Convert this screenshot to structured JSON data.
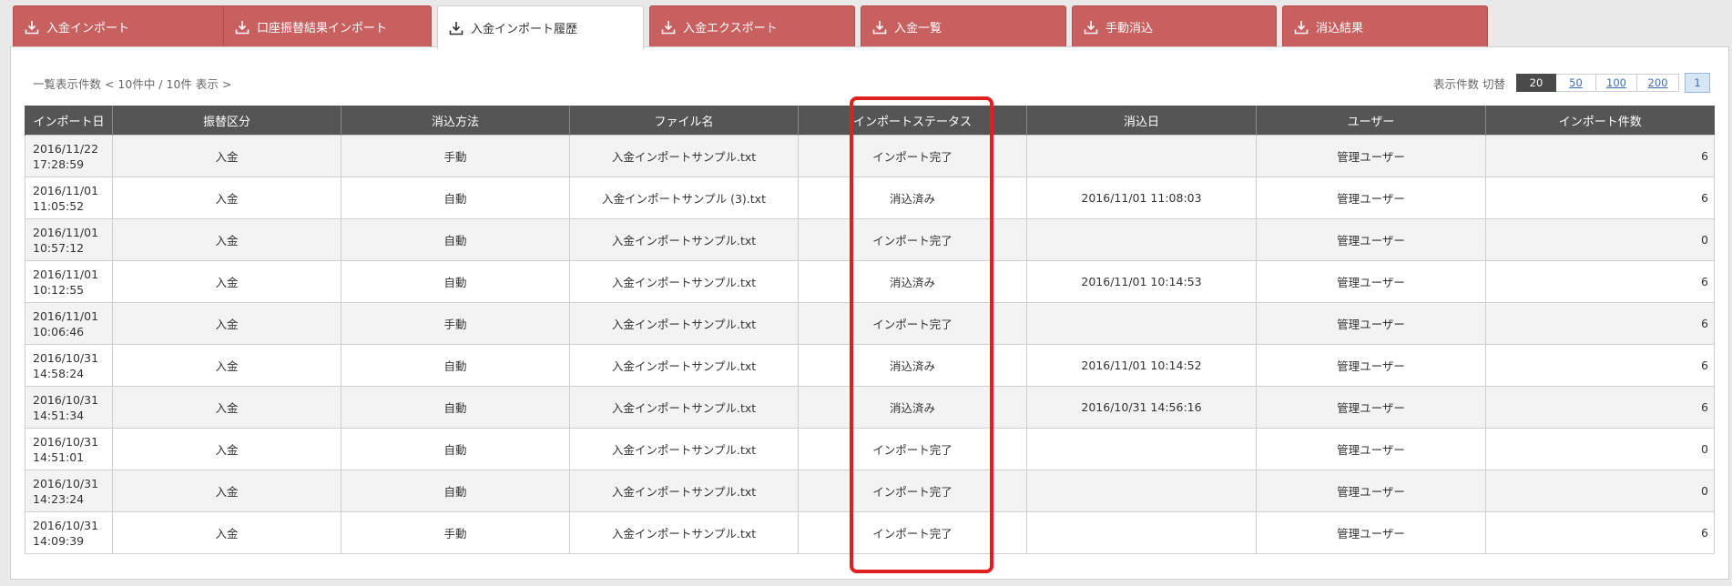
{
  "tabs": [
    {
      "label": "入金インポート",
      "icon": "download-icon",
      "active": false
    },
    {
      "label": "口座振替結果インポート",
      "icon": "download-icon",
      "active": false
    },
    {
      "label": "入金インポート履歴",
      "icon": "download-icon",
      "active": true
    },
    {
      "label": "入金エクスポート",
      "icon": "download-icon",
      "active": false
    },
    {
      "label": "入金一覧",
      "icon": "download-icon",
      "active": false
    },
    {
      "label": "手動消込",
      "icon": "download-icon",
      "active": false
    },
    {
      "label": "消込結果",
      "icon": "download-icon",
      "active": false
    }
  ],
  "summary": "一覧表示件数 < 10件中 / 10件 表示 >",
  "pager": {
    "label": "表示件数 切替",
    "sizes": [
      "20",
      "50",
      "100",
      "200"
    ],
    "selected_size": "20",
    "current_page": "1"
  },
  "table": {
    "headers": [
      "インポート日",
      "振替区分",
      "消込方法",
      "ファイル名",
      "インポートステータス",
      "消込日",
      "ユーザー",
      "インポート件数"
    ],
    "rows": [
      [
        "2016/11/22 17:28:59",
        "入金",
        "手動",
        "入金インポートサンプル.txt",
        "インポート完了",
        "",
        "管理ユーザー",
        "6"
      ],
      [
        "2016/11/01 11:05:52",
        "入金",
        "自動",
        "入金インポートサンプル (3).txt",
        "消込済み",
        "2016/11/01 11:08:03",
        "管理ユーザー",
        "6"
      ],
      [
        "2016/11/01 10:57:12",
        "入金",
        "自動",
        "入金インポートサンプル.txt",
        "インポート完了",
        "",
        "管理ユーザー",
        "0"
      ],
      [
        "2016/11/01 10:12:55",
        "入金",
        "自動",
        "入金インポートサンプル.txt",
        "消込済み",
        "2016/11/01 10:14:53",
        "管理ユーザー",
        "6"
      ],
      [
        "2016/11/01 10:06:46",
        "入金",
        "手動",
        "入金インポートサンプル.txt",
        "インポート完了",
        "",
        "管理ユーザー",
        "6"
      ],
      [
        "2016/10/31 14:58:24",
        "入金",
        "自動",
        "入金インポートサンプル.txt",
        "消込済み",
        "2016/11/01 10:14:52",
        "管理ユーザー",
        "6"
      ],
      [
        "2016/10/31 14:51:34",
        "入金",
        "自動",
        "入金インポートサンプル.txt",
        "消込済み",
        "2016/10/31 14:56:16",
        "管理ユーザー",
        "6"
      ],
      [
        "2016/10/31 14:51:01",
        "入金",
        "自動",
        "入金インポートサンプル.txt",
        "インポート完了",
        "",
        "管理ユーザー",
        "0"
      ],
      [
        "2016/10/31 14:23:24",
        "入金",
        "自動",
        "入金インポートサンプル.txt",
        "インポート完了",
        "",
        "管理ユーザー",
        "0"
      ],
      [
        "2016/10/31 14:09:39",
        "入金",
        "手動",
        "入金インポートサンプル.txt",
        "インポート完了",
        "",
        "管理ユーザー",
        "6"
      ]
    ]
  },
  "colors": {
    "tab_bg": "#c96060",
    "header_bg": "#555555",
    "highlight": "#e02020",
    "link": "#3a6fb0"
  }
}
